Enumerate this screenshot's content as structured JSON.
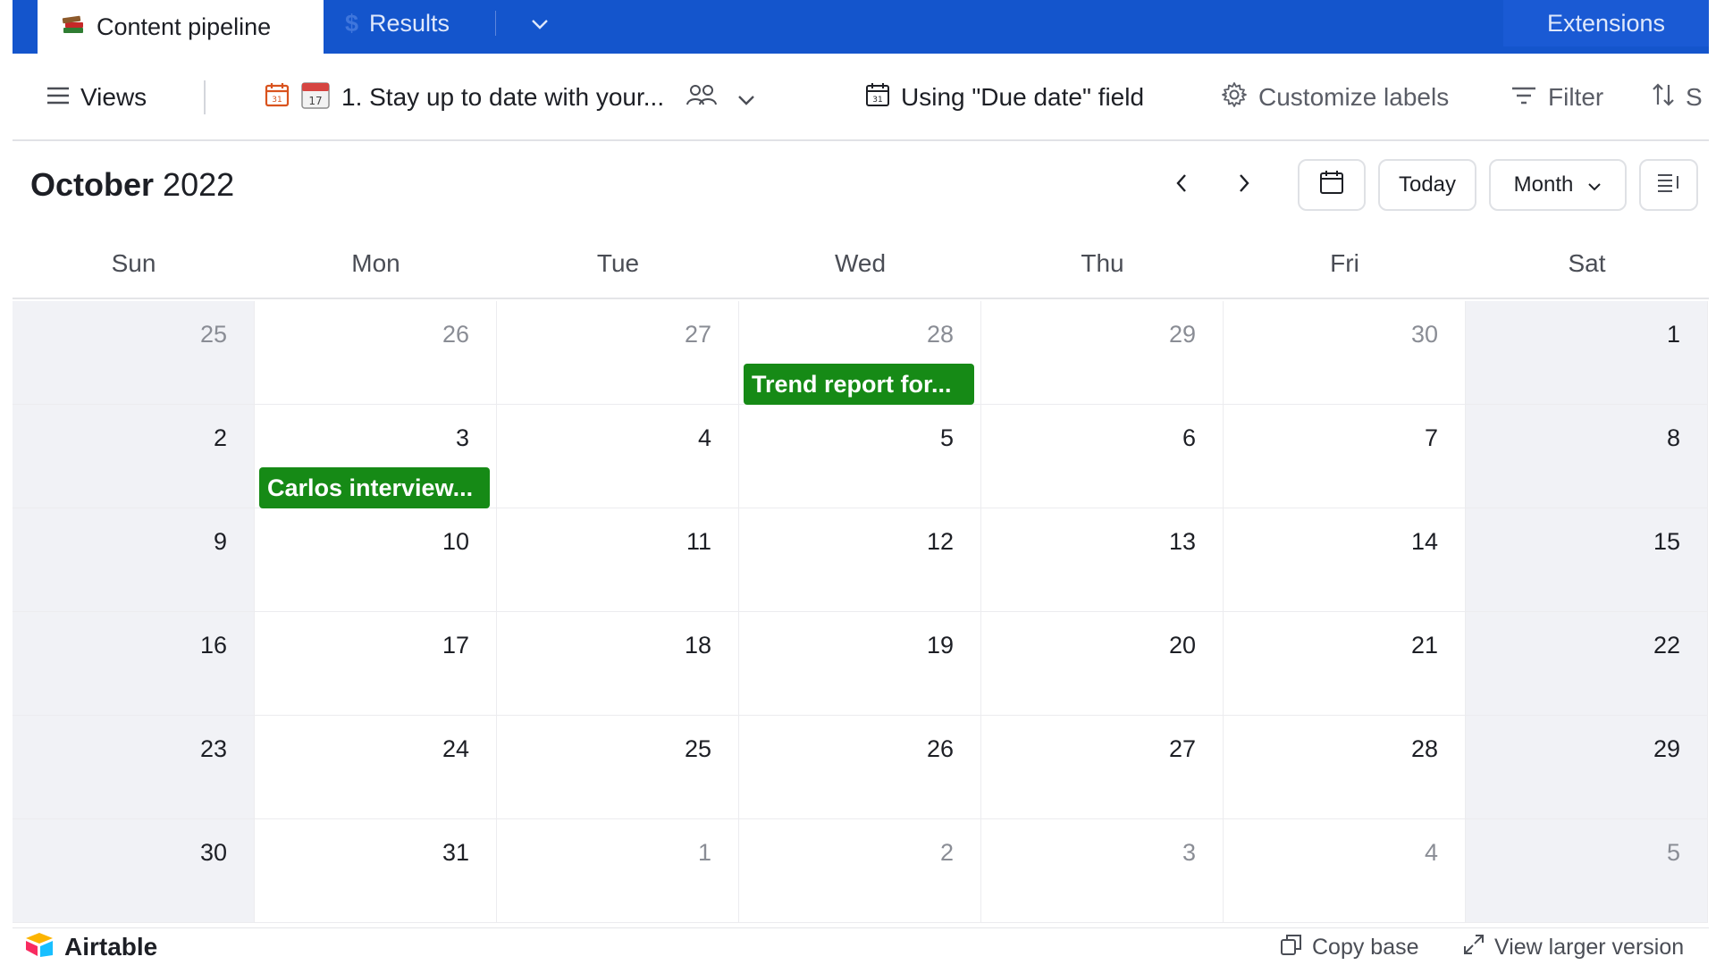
{
  "tabs": {
    "active_label": "Content pipeline",
    "other_label": "Results",
    "extensions_label": "Extensions"
  },
  "toolbar": {
    "views_label": "Views",
    "view_name": "1. Stay up to date with your...",
    "date_field_label": "Using \"Due date\" field",
    "customize_label": "Customize labels",
    "filter_label": "Filter",
    "sort_label": "S"
  },
  "calendar": {
    "month": "October",
    "year": "2022",
    "today_label": "Today",
    "mode_label": "Month",
    "weekdays": [
      "Sun",
      "Mon",
      "Tue",
      "Wed",
      "Thu",
      "Fri",
      "Sat"
    ],
    "weeks": [
      [
        {
          "d": "25",
          "other": true
        },
        {
          "d": "26",
          "other": true
        },
        {
          "d": "27",
          "other": true
        },
        {
          "d": "28",
          "other": true
        },
        {
          "d": "29",
          "other": true
        },
        {
          "d": "30",
          "other": true
        },
        {
          "d": "1",
          "other": false
        }
      ],
      [
        {
          "d": "2",
          "other": false
        },
        {
          "d": "3",
          "other": false
        },
        {
          "d": "4",
          "other": false
        },
        {
          "d": "5",
          "other": false
        },
        {
          "d": "6",
          "other": false
        },
        {
          "d": "7",
          "other": false
        },
        {
          "d": "8",
          "other": false
        }
      ],
      [
        {
          "d": "9",
          "other": false
        },
        {
          "d": "10",
          "other": false
        },
        {
          "d": "11",
          "other": false
        },
        {
          "d": "12",
          "other": false
        },
        {
          "d": "13",
          "other": false
        },
        {
          "d": "14",
          "other": false
        },
        {
          "d": "15",
          "other": false
        }
      ],
      [
        {
          "d": "16",
          "other": false
        },
        {
          "d": "17",
          "other": false
        },
        {
          "d": "18",
          "other": false
        },
        {
          "d": "19",
          "other": false
        },
        {
          "d": "20",
          "other": false
        },
        {
          "d": "21",
          "other": false
        },
        {
          "d": "22",
          "other": false
        }
      ],
      [
        {
          "d": "23",
          "other": false
        },
        {
          "d": "24",
          "other": false
        },
        {
          "d": "25",
          "other": false
        },
        {
          "d": "26",
          "other": false
        },
        {
          "d": "27",
          "other": false
        },
        {
          "d": "28",
          "other": false
        },
        {
          "d": "29",
          "other": false
        }
      ],
      [
        {
          "d": "30",
          "other": false
        },
        {
          "d": "31",
          "other": false
        },
        {
          "d": "1",
          "other": true
        },
        {
          "d": "2",
          "other": true
        },
        {
          "d": "3",
          "other": true
        },
        {
          "d": "4",
          "other": true
        },
        {
          "d": "5",
          "other": true
        }
      ]
    ],
    "events": [
      {
        "label": "Trend report for...",
        "week": 0,
        "day": 3
      },
      {
        "label": "Carlos interview...",
        "week": 1,
        "day": 1
      }
    ]
  },
  "footer": {
    "logo_label": "Airtable",
    "copy_label": "Copy base",
    "larger_label": "View larger version"
  },
  "colors": {
    "topbar": "#1455cc",
    "event_green": "#168a16",
    "weekend_bg": "#f1f2f6"
  }
}
